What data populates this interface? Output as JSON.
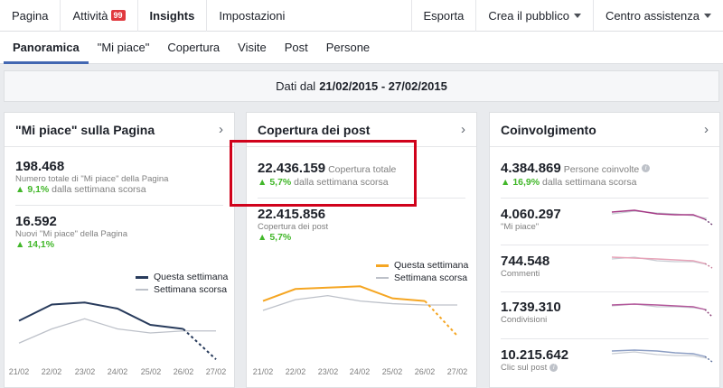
{
  "topnav": {
    "left": [
      {
        "label": "Pagina"
      },
      {
        "label": "Attività",
        "badge": "99"
      },
      {
        "label": "Insights"
      },
      {
        "label": "Impostazioni"
      }
    ],
    "right": [
      {
        "label": "Esporta"
      },
      {
        "label": "Crea il pubblico"
      },
      {
        "label": "Centro assistenza"
      }
    ]
  },
  "subnav": {
    "tabs": [
      "Panoramica",
      "\"Mi piace\"",
      "Copertura",
      "Visite",
      "Post",
      "Persone"
    ]
  },
  "datebar": {
    "prefix": "Dati dal",
    "range": "21/02/2015 - 27/02/2015"
  },
  "colors": {
    "accent": "#4267b2",
    "positive": "#42b72a",
    "likes_line": "#283b5c",
    "reach_line": "#f5a623",
    "prev_week": "#bdc1c9",
    "highlight": "#d0021b"
  },
  "likes_card": {
    "title": "\"Mi piace\" sulla Pagina",
    "total_value": "198.468",
    "total_label": "Numero totale di \"Mi piace\" della Pagina",
    "total_delta": "9,1%",
    "total_delta_text": "dalla settimana scorsa",
    "new_value": "16.592",
    "new_label": "Nuovi \"Mi piace\" della Pagina",
    "new_delta": "14,1%",
    "legend_current": "Questa settimana",
    "legend_previous": "Settimana scorsa",
    "x_labels": [
      "21/02",
      "22/02",
      "23/02",
      "24/02",
      "25/02",
      "26/02",
      "27/02"
    ]
  },
  "reach_card": {
    "title": "Copertura dei post",
    "total_value": "22.436.159",
    "total_label": "Copertura totale",
    "total_delta": "5,7%",
    "total_delta_text": "dalla settimana scorsa",
    "post_value": "22.415.856",
    "post_label": "Copertura dei post",
    "post_delta": "5,7%",
    "legend_current": "Questa settimana",
    "legend_previous": "Settimana scorsa",
    "x_labels": [
      "21/02",
      "22/02",
      "23/02",
      "24/02",
      "25/02",
      "26/02",
      "27/02"
    ]
  },
  "engagement_card": {
    "title": "Coinvolgimento",
    "people_value": "4.384.869",
    "people_label": "Persone coinvolte",
    "people_delta": "16,9%",
    "people_delta_text": "dalla settimana scorsa",
    "rows": [
      {
        "value": "4.060.297",
        "label": "\"Mi piace\""
      },
      {
        "value": "744.548",
        "label": "Commenti"
      },
      {
        "value": "1.739.310",
        "label": "Condivisioni"
      },
      {
        "value": "10.215.642",
        "label": "Clic sul post"
      }
    ]
  },
  "chart_data": [
    {
      "type": "line",
      "x": [
        "21/02",
        "22/02",
        "23/02",
        "24/02",
        "25/02",
        "26/02",
        "27/02"
      ],
      "series": [
        {
          "name": "Questa settimana",
          "values": [
            2400,
            2800,
            2850,
            2700,
            2300,
            2200,
            1450
          ]
        },
        {
          "name": "Settimana scorsa",
          "values": [
            1850,
            2200,
            2450,
            2200,
            2100,
            2150,
            2150
          ]
        }
      ],
      "ylim": [
        1300,
        3300
      ],
      "grid": false,
      "legend": "top-right"
    },
    {
      "type": "line",
      "x": [
        "21/02",
        "22/02",
        "23/02",
        "24/02",
        "25/02",
        "26/02",
        "27/02"
      ],
      "series": [
        {
          "name": "Questa settimana",
          "values": [
            3300000,
            3750000,
            3800000,
            3850000,
            3400000,
            3300000,
            2000000
          ]
        },
        {
          "name": "Settimana scorsa",
          "values": [
            2950000,
            3350000,
            3500000,
            3300000,
            3200000,
            3150000,
            3150000
          ]
        }
      ],
      "ylim": [
        1700000,
        4400000
      ],
      "grid": false,
      "legend": "top-right"
    }
  ]
}
